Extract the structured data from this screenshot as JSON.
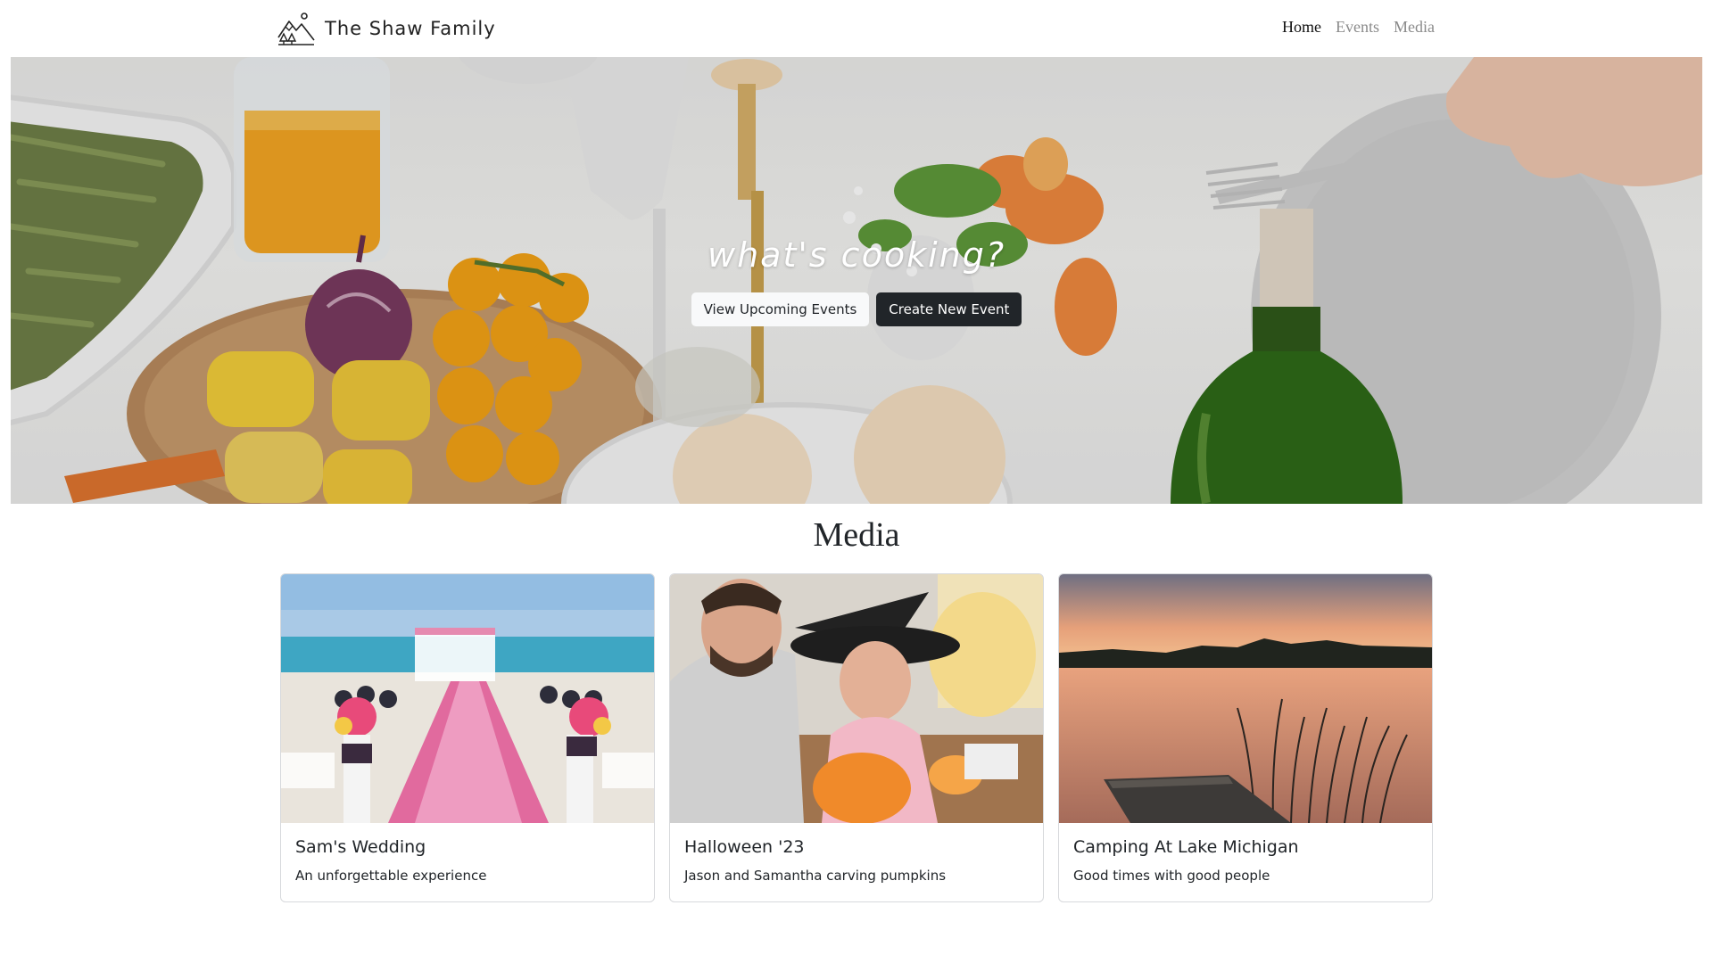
{
  "navbar": {
    "brand": "The Shaw Family",
    "links": [
      {
        "label": "Home",
        "active": true
      },
      {
        "label": "Events",
        "active": false
      },
      {
        "label": "Media",
        "active": false
      }
    ]
  },
  "hero": {
    "title": "what's cooking?",
    "buttons": {
      "primary": "View Upcoming Events",
      "secondary": "Create New Event"
    }
  },
  "media": {
    "heading": "Media",
    "cards": [
      {
        "title": "Sam's Wedding",
        "text": "An unforgettable experience"
      },
      {
        "title": "Halloween '23",
        "text": "Jason and Samantha carving pumpkins"
      },
      {
        "title": "Camping At Lake Michigan",
        "text": "Good times with good people"
      }
    ]
  },
  "colors": {
    "dark_button": "#212529",
    "light_button": "#f8f9fa",
    "nav_active": "#111111",
    "nav_inactive": "#8a8a8a"
  },
  "icons": {
    "brand_logo": "mountains-trees-icon"
  }
}
